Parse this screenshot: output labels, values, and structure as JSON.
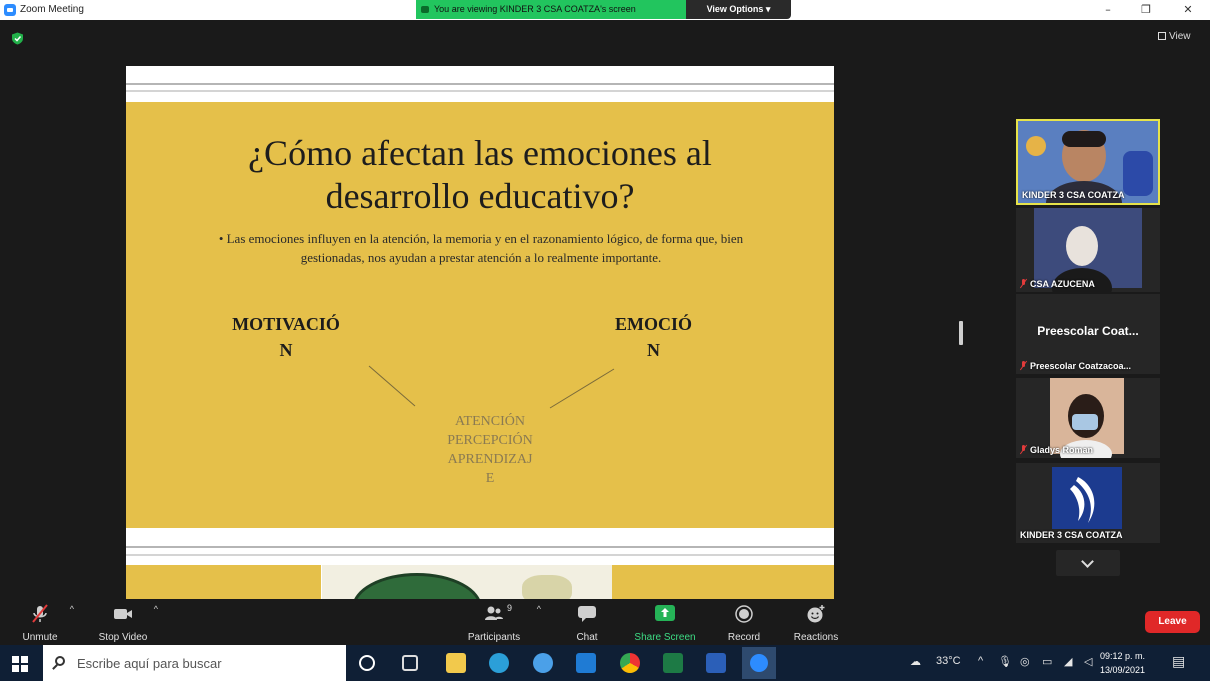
{
  "window": {
    "title": "Zoom Meeting"
  },
  "banner": {
    "text": "You are viewing KINDER 3 CSA COATZA's screen",
    "options_label": "View Options ▾"
  },
  "view_label": "View",
  "slide": {
    "title_line1": "¿Cómo afectan las emociones al",
    "title_line2": "desarrollo educativo?",
    "bullet_line1": "• Las emociones influyen en la atención, la memoria y en el razonamiento lógico, de forma que, bien",
    "bullet_line2": "gestionadas, nos ayudan a prestar atención a lo realmente importante.",
    "left_word_line1": "MOTIVACIÓ",
    "left_word_line2": "N",
    "right_word_line1": "EMOCIÓ",
    "right_word_line2": "N",
    "center_line1": "ATENCIÓN",
    "center_line2": "PERCEPCIÓN",
    "center_line3": "APRENDIZAJ",
    "center_line4": "E"
  },
  "participants": [
    {
      "name": "KINDER 3 CSA COATZA"
    },
    {
      "name": "CSA AZUCENA"
    },
    {
      "name": "Preescolar Coatzacoa...",
      "display": "Preescolar  Coat..."
    },
    {
      "name": "Gladys Roman"
    },
    {
      "name": "KINDER 3 CSA COATZA"
    }
  ],
  "toolbar": {
    "unmute": "Unmute",
    "stop_video": "Stop Video",
    "participants": "Participants",
    "participants_count": "9",
    "chat": "Chat",
    "share_screen": "Share Screen",
    "record": "Record",
    "reactions": "Reactions",
    "leave": "Leave"
  },
  "taskbar": {
    "search_placeholder": "Escribe aquí para buscar",
    "temperature": "33°C",
    "time": "09:12 p. m.",
    "date": "13/09/2021"
  },
  "colors": {
    "slide_yellow": "#e5c04a",
    "banner_green": "#22c55e",
    "leave_red": "#e02828",
    "active_speaker": "#e7e34a"
  }
}
